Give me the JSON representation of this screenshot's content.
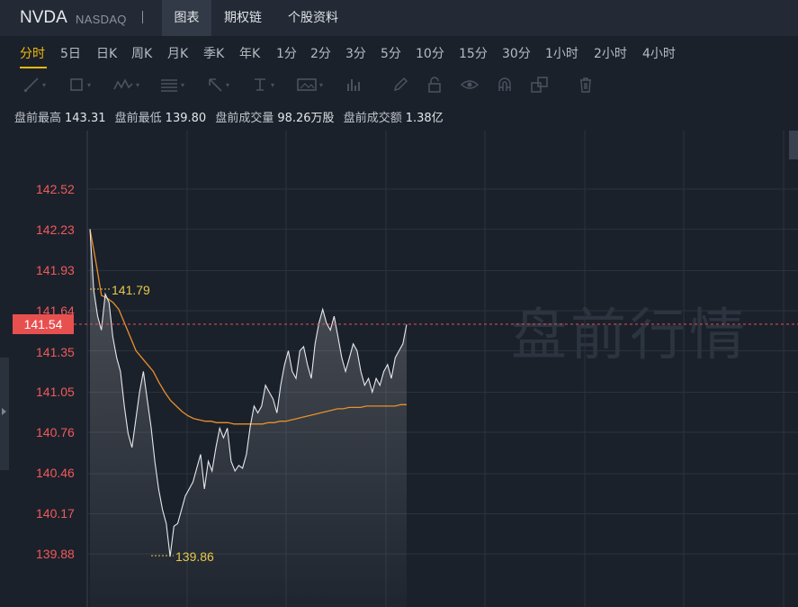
{
  "header": {
    "symbol": "NVDA",
    "exchange": "NASDAQ",
    "tabs": [
      {
        "label": "图表",
        "active": true
      },
      {
        "label": "期权链",
        "active": false
      },
      {
        "label": "个股资料",
        "active": false
      }
    ]
  },
  "periods": [
    {
      "label": "分时",
      "active": true
    },
    {
      "label": "5日"
    },
    {
      "label": "日K"
    },
    {
      "label": "周K"
    },
    {
      "label": "月K"
    },
    {
      "label": "季K"
    },
    {
      "label": "年K"
    },
    {
      "label": "1分"
    },
    {
      "label": "2分"
    },
    {
      "label": "3分"
    },
    {
      "label": "5分"
    },
    {
      "label": "10分"
    },
    {
      "label": "15分"
    },
    {
      "label": "30分"
    },
    {
      "label": "1小时"
    },
    {
      "label": "2小时"
    },
    {
      "label": "4小时"
    }
  ],
  "toolbar": {
    "tools": [
      "line-tool-icon",
      "rectangle-tool-icon",
      "pattern-tool-icon",
      "fibonacci-tool-icon",
      "arrow-tool-icon",
      "text-tool-icon",
      "image-tool-icon",
      "bar-tool-icon",
      "pencil-icon",
      "lock-icon",
      "eye-icon",
      "magnet-icon",
      "layers-icon",
      "trash-icon"
    ]
  },
  "stats": {
    "high_label": "盘前最高",
    "high_value": "143.31",
    "low_label": "盘前最低",
    "low_value": "139.80",
    "volume_label": "盘前成交量",
    "volume_value": "98.26万股",
    "amount_label": "盘前成交额",
    "amount_value": "1.38亿"
  },
  "chart_data": {
    "type": "line",
    "y_ticks": [
      "142.52",
      "142.23",
      "141.93",
      "141.64",
      "141.35",
      "141.05",
      "140.76",
      "140.46",
      "140.17",
      "139.88"
    ],
    "current_price": "141.54",
    "annotations": {
      "high": "141.79",
      "low": "139.86"
    },
    "watermark": "盘前行情",
    "ylim": [
      139.88,
      142.52
    ],
    "price": [
      142.23,
      141.79,
      141.6,
      141.5,
      141.76,
      141.7,
      141.45,
      141.3,
      141.2,
      140.95,
      140.75,
      140.65,
      140.85,
      141.05,
      141.2,
      141.0,
      140.8,
      140.55,
      140.35,
      140.2,
      140.1,
      139.86,
      140.08,
      140.1,
      140.2,
      140.3,
      140.35,
      140.4,
      140.5,
      140.6,
      140.35,
      140.55,
      140.48,
      140.65,
      140.79,
      140.72,
      140.79,
      140.55,
      140.48,
      140.52,
      140.5,
      140.6,
      140.8,
      140.95,
      140.9,
      140.95,
      141.1,
      141.05,
      141.0,
      140.9,
      141.1,
      141.25,
      141.35,
      141.2,
      141.15,
      141.35,
      141.38,
      141.25,
      141.15,
      141.4,
      141.55,
      141.65,
      141.55,
      141.5,
      141.6,
      141.45,
      141.3,
      141.2,
      141.3,
      141.4,
      141.35,
      141.2,
      141.1,
      141.15,
      141.05,
      141.15,
      141.1,
      141.2,
      141.25,
      141.15,
      141.3,
      141.35,
      141.4,
      141.54
    ],
    "avg": [
      142.23,
      142.0,
      141.75,
      141.73,
      141.7,
      141.65,
      141.55,
      141.45,
      141.35,
      141.3,
      141.25,
      141.2,
      141.12,
      141.05,
      140.99,
      140.95,
      140.91,
      140.88,
      140.86,
      140.85,
      140.84,
      140.84,
      140.83,
      140.83,
      140.83,
      140.82,
      140.82,
      140.82,
      140.82,
      140.82,
      140.82,
      140.83,
      140.83,
      140.84,
      140.84,
      140.85,
      140.86,
      140.87,
      140.88,
      140.89,
      140.9,
      140.91,
      140.92,
      140.93,
      140.93,
      140.94,
      140.94,
      140.94,
      140.95,
      140.95,
      140.95,
      140.95,
      140.95,
      140.95,
      140.96,
      140.96
    ]
  }
}
